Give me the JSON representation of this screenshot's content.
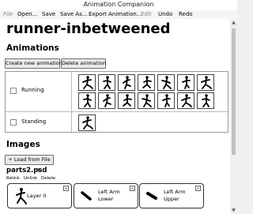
{
  "window": {
    "title": "Animation Companion"
  },
  "menu": {
    "file": "File",
    "open": "Open...",
    "save": "Save",
    "save_as": "Save As...",
    "export": "Export Animation...",
    "edit": "Edit",
    "undo": "Undo",
    "redo": "Redo"
  },
  "project": {
    "name": "runner-inbetweened"
  },
  "animations": {
    "heading": "Animations",
    "create_label": "Create new animation",
    "delete_label": "Delete animation",
    "items": [
      {
        "name": "Running",
        "checked": false,
        "frame_count": 14
      },
      {
        "name": "Standing",
        "checked": false,
        "frame_count": 1
      }
    ]
  },
  "images": {
    "heading": "Images",
    "load_label": "+ Load from File",
    "file": {
      "name": "parts2.psd",
      "actions": [
        "Relink",
        "Unlink",
        "Delete"
      ],
      "layers": [
        {
          "name_lines": [
            "Layer 0"
          ]
        },
        {
          "name_lines": [
            "Left Arm",
            "Lower"
          ]
        },
        {
          "name_lines": [
            "Left Arm",
            "Upper"
          ]
        }
      ]
    }
  },
  "colors": {
    "accent": "#000000",
    "panel": "#ffffff",
    "chrome": "#f0f0f0"
  }
}
